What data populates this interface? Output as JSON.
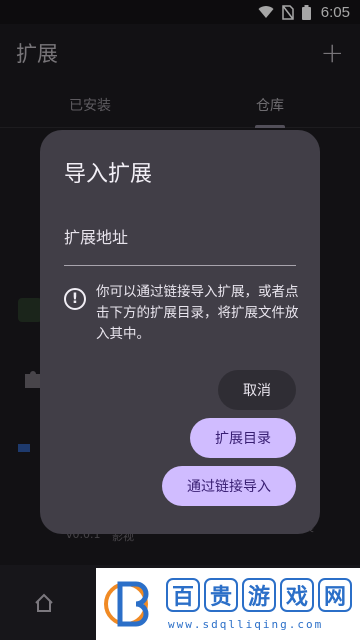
{
  "status_bar": {
    "time": "6:05"
  },
  "app_bar": {
    "title": "扩展",
    "add_label": "+"
  },
  "tabs": [
    {
      "label": "已安装",
      "active": false
    },
    {
      "label": "仓库",
      "active": true
    }
  ],
  "background": {
    "version": "v0.0.1",
    "category": "影视",
    "side_text": "展"
  },
  "dialog": {
    "title": "导入扩展",
    "field_label": "扩展地址",
    "info_text": "你可以通过链接导入扩展，或者点击下方的扩展目录，将扩展文件放入其中。",
    "cancel_label": "取消",
    "catalog_label": "扩展目录",
    "link_import_label": "通过链接导入"
  },
  "watermark": {
    "chars": [
      "百",
      "贵",
      "游",
      "戏",
      "网"
    ],
    "url": "www.sdqlliqing.com"
  },
  "colors": {
    "accent": "#d0bcff",
    "dialog_bg": "#413e47",
    "page_bg": "#1c1b1f"
  }
}
